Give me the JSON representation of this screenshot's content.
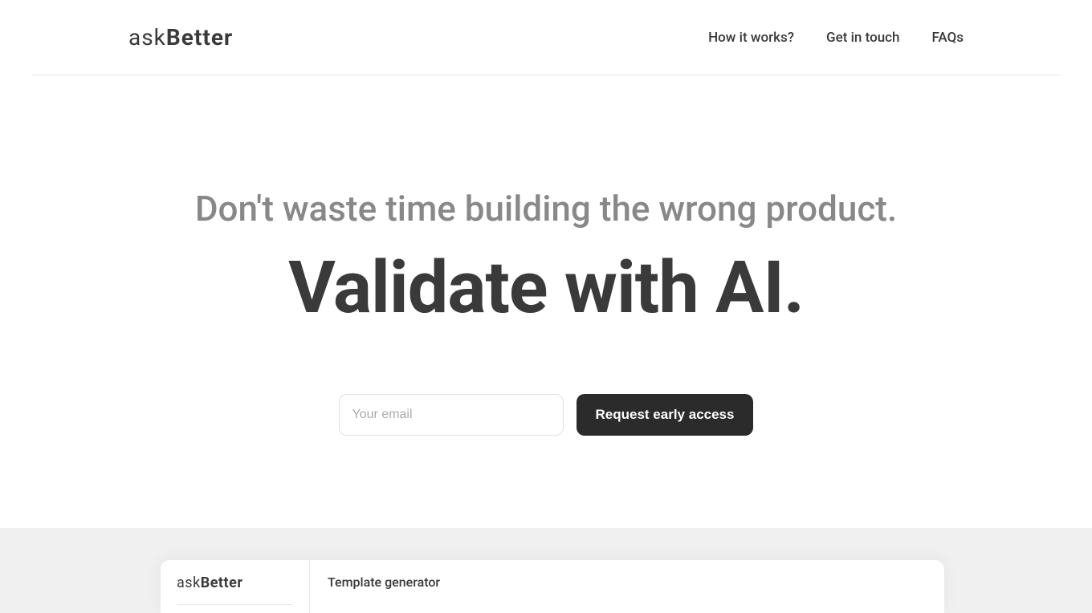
{
  "logo": {
    "light": "ask",
    "bold": "Better"
  },
  "nav": {
    "items": [
      "How it works?",
      "Get in touch",
      "FAQs"
    ]
  },
  "hero": {
    "subtitle": "Don't waste time building the wrong product.",
    "title": "Validate with AI."
  },
  "cta": {
    "email_placeholder": "Your email",
    "button_label": "Request early access"
  },
  "app_preview": {
    "logo_light": "ask",
    "logo_bold": "Better",
    "main_title": "Template generator"
  }
}
